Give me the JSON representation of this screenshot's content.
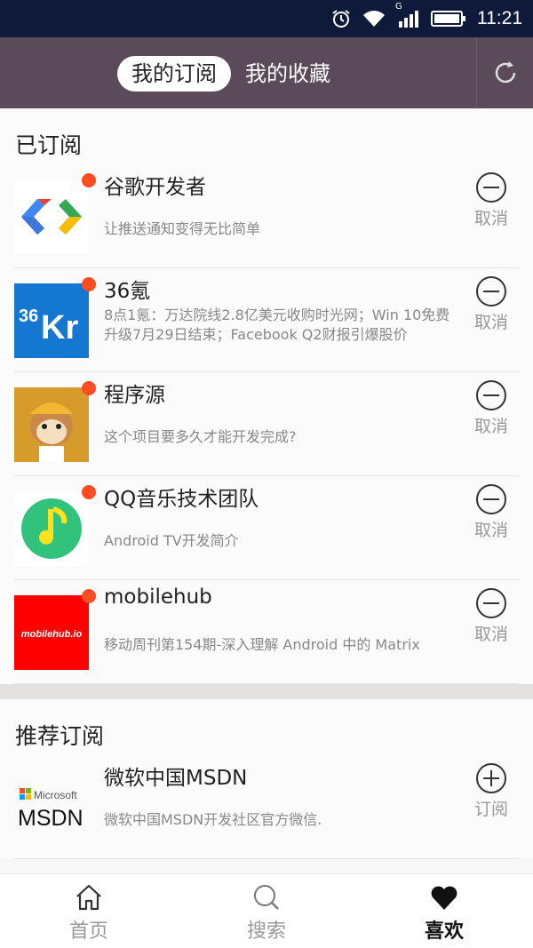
{
  "status_bar": {
    "time": "11:21",
    "icons": [
      "alarm-icon",
      "wifi-icon",
      "signal-icon",
      "battery-icon"
    ],
    "network_label": "G"
  },
  "header": {
    "tabs": [
      {
        "label": "我的订阅",
        "active": true
      },
      {
        "label": "我的收藏",
        "active": false
      }
    ],
    "refresh_icon": "refresh-icon",
    "bg_color": "#5b4a59"
  },
  "subscribed": {
    "title": "已订阅",
    "action_label": "取消",
    "items": [
      {
        "name": "谷歌开发者",
        "desc": "让推送通知变得无比简单",
        "logo": "google-developers-logo"
      },
      {
        "name": "36氪",
        "desc": "8点1氪：万达院线2.8亿美元收购时光网；Win 10免费升级7月29日结束；Facebook Q2财报引爆股价",
        "logo": "36kr-logo",
        "logo_text_a": "36",
        "logo_text_b": "Kr"
      },
      {
        "name": "程序源",
        "desc": "这个项目要多久才能开发完成?",
        "logo": "monkey-avatar-logo"
      },
      {
        "name": "QQ音乐技术团队",
        "desc": "Android TV开发简介",
        "logo": "qq-music-logo"
      },
      {
        "name": "mobilehub",
        "desc": "移动周刊第154期-深入理解 Android 中的 Matrix",
        "logo": "mobilehub-logo",
        "logo_text": "mobilehub.io"
      }
    ]
  },
  "recommended": {
    "title": "推荐订阅",
    "action_label": "订阅",
    "items": [
      {
        "name": "微软中国MSDN",
        "desc": "微软中国MSDN开发社区官方微信.",
        "logo": "msdn-logo",
        "logo_text_a": "Microsoft",
        "logo_text_b": "MSDN"
      }
    ]
  },
  "bottom_nav": [
    {
      "label": "首页",
      "icon": "home-icon",
      "active": false
    },
    {
      "label": "搜索",
      "icon": "search-icon",
      "active": false
    },
    {
      "label": "喜欢",
      "icon": "heart-icon",
      "active": true
    }
  ],
  "colors": {
    "status_bar": "#0f1a3a",
    "unread_dot": "#ff4d22",
    "divider": "#e4e1e1"
  }
}
